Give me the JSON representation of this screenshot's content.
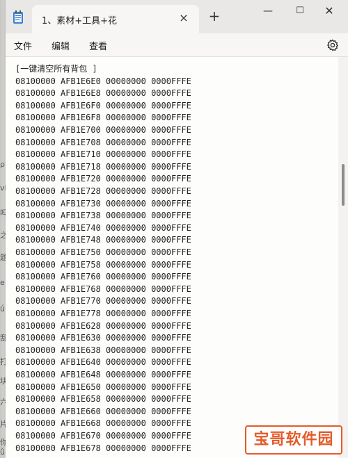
{
  "window": {
    "tab_title": "1、素材+工具+花",
    "tab_close": "×",
    "new_tab": "+",
    "minimize": "—",
    "maximize": "☐",
    "close": "✕"
  },
  "menu": {
    "file": "文件",
    "edit": "编辑",
    "view": "查看"
  },
  "background_glyphs": [
    "ρ",
    "vi",
    "吗",
    "之",
    "题",
    "e",
    "ǘ",
    "乱",
    "打",
    "块",
    "六",
    "片",
    "你",
    "ǚ"
  ],
  "editor": {
    "lines": [
      "[一键清空所有背包 ]",
      "08100000 AFB1E6E0 00000000 0000FFFE",
      "08100000 AFB1E6E8 00000000 0000FFFE",
      "08100000 AFB1E6F0 00000000 0000FFFE",
      "08100000 AFB1E6F8 00000000 0000FFFE",
      "08100000 AFB1E700 00000000 0000FFFE",
      "08100000 AFB1E708 00000000 0000FFFE",
      "08100000 AFB1E710 00000000 0000FFFE",
      "08100000 AFB1E718 00000000 0000FFFE",
      "08100000 AFB1E720 00000000 0000FFFE",
      "08100000 AFB1E728 00000000 0000FFFE",
      "08100000 AFB1E730 00000000 0000FFFE",
      "08100000 AFB1E738 00000000 0000FFFE",
      "08100000 AFB1E740 00000000 0000FFFE",
      "08100000 AFB1E748 00000000 0000FFFE",
      "08100000 AFB1E750 00000000 0000FFFE",
      "08100000 AFB1E758 00000000 0000FFFE",
      "08100000 AFB1E760 00000000 0000FFFE",
      "08100000 AFB1E768 00000000 0000FFFE",
      "08100000 AFB1E770 00000000 0000FFFE",
      "08100000 AFB1E778 00000000 0000FFFE",
      "08100000 AFB1E628 00000000 0000FFFE",
      "08100000 AFB1E630 00000000 0000FFFE",
      "08100000 AFB1E638 00000000 0000FFFE",
      "08100000 AFB1E640 00000000 0000FFFE",
      "08100000 AFB1E648 00000000 0000FFFE",
      "08100000 AFB1E650 00000000 0000FFFE",
      "08100000 AFB1E658 00000000 0000FFFE",
      "08100000 AFB1E660 00000000 0000FFFE",
      "08100000 AFB1E668 00000000 0000FFFE",
      "08100000 AFB1E670 00000000 0000FFFE",
      "08100000 AFB1E678 00000000 0000FFFE"
    ]
  },
  "watermark": "宝哥软件园",
  "colors": {
    "accent": "#e45b2a",
    "titlebar": "#e9e8e6",
    "editor_bg": "#fdfdfc"
  }
}
